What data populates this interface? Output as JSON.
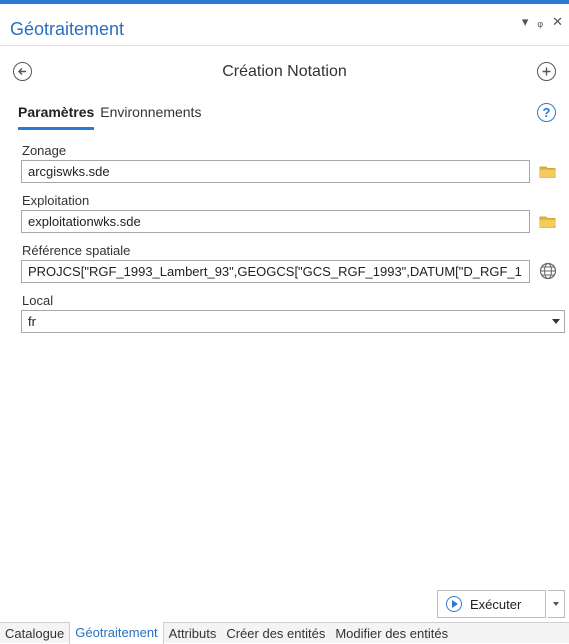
{
  "pane": {
    "title": "Géotraitement",
    "controls": {
      "menu": "▾",
      "pin": "ᵩ",
      "close": "✕"
    }
  },
  "tool": {
    "title": "Création Notation",
    "back_icon": "back-arrow-icon",
    "add_icon": "plus-icon"
  },
  "tabs": [
    {
      "label": "Paramètres",
      "active": true
    },
    {
      "label": "Environnements",
      "active": false
    }
  ],
  "help": {
    "label": "?"
  },
  "params": {
    "zonage": {
      "label": "Zonage",
      "value": "arcgiswks.sde"
    },
    "exploitation": {
      "label": "Exploitation",
      "value": "exploitationwks.sde"
    },
    "reference": {
      "label": "Référence spatiale",
      "value": "PROJCS[\"RGF_1993_Lambert_93\",GEOGCS[\"GCS_RGF_1993\",DATUM[\"D_RGF_1"
    },
    "local": {
      "label": "Local",
      "value": "fr"
    }
  },
  "run": {
    "label": "Exécuter"
  },
  "bottom_tabs": [
    {
      "label": "Catalogue",
      "active": false
    },
    {
      "label": "Géotraitement",
      "active": true
    },
    {
      "label": "Attributs",
      "active": false
    },
    {
      "label": "Créer des entités",
      "active": false
    },
    {
      "label": "Modifier des entités",
      "active": false
    }
  ],
  "colors": {
    "accent": "#2a7ad2",
    "folder": "#e8b437",
    "title": "#2a6fbf"
  }
}
